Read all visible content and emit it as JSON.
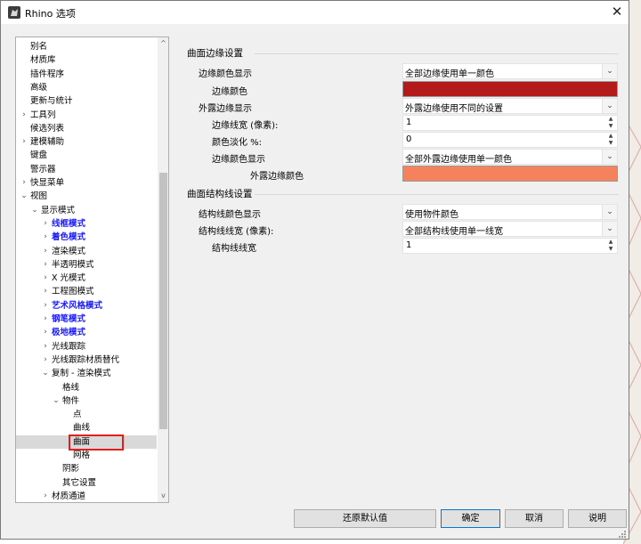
{
  "window": {
    "title": "Rhino 选项",
    "close_glyph": "✕"
  },
  "colors": {
    "edge_color": "#b31b1b",
    "naked_edge_color": "#f5825c",
    "selection_highlight": "#e0201c",
    "link_blue": "#1a1aff"
  },
  "tree": {
    "items": [
      {
        "label": "别名",
        "level": 0,
        "expander": "",
        "blue": false,
        "selected": false
      },
      {
        "label": "材质库",
        "level": 0,
        "expander": "",
        "blue": false,
        "selected": false
      },
      {
        "label": "插件程序",
        "level": 0,
        "expander": "",
        "blue": false,
        "selected": false
      },
      {
        "label": "高级",
        "level": 0,
        "expander": "",
        "blue": false,
        "selected": false
      },
      {
        "label": "更新与统计",
        "level": 0,
        "expander": "",
        "blue": false,
        "selected": false
      },
      {
        "label": "工具列",
        "level": 0,
        "expander": ">",
        "blue": false,
        "selected": false
      },
      {
        "label": "候选列表",
        "level": 0,
        "expander": "",
        "blue": false,
        "selected": false
      },
      {
        "label": "建模辅助",
        "level": 0,
        "expander": ">",
        "blue": false,
        "selected": false
      },
      {
        "label": "键盘",
        "level": 0,
        "expander": "",
        "blue": false,
        "selected": false
      },
      {
        "label": "警示器",
        "level": 0,
        "expander": "",
        "blue": false,
        "selected": false
      },
      {
        "label": "快显菜单",
        "level": 0,
        "expander": ">",
        "blue": false,
        "selected": false
      },
      {
        "label": "视图",
        "level": 0,
        "expander": "v",
        "blue": false,
        "selected": false
      },
      {
        "label": "显示模式",
        "level": 1,
        "expander": "v",
        "blue": false,
        "selected": false
      },
      {
        "label": "线框模式",
        "level": 2,
        "expander": ">",
        "blue": true,
        "selected": false
      },
      {
        "label": "着色模式",
        "level": 2,
        "expander": ">",
        "blue": true,
        "selected": false
      },
      {
        "label": "渲染模式",
        "level": 2,
        "expander": ">",
        "blue": false,
        "selected": false
      },
      {
        "label": "半透明模式",
        "level": 2,
        "expander": ">",
        "blue": false,
        "selected": false
      },
      {
        "label": "X 光模式",
        "level": 2,
        "expander": ">",
        "blue": false,
        "selected": false
      },
      {
        "label": "工程图模式",
        "level": 2,
        "expander": ">",
        "blue": false,
        "selected": false
      },
      {
        "label": "艺术风格模式",
        "level": 2,
        "expander": ">",
        "blue": true,
        "selected": false
      },
      {
        "label": "钢笔模式",
        "level": 2,
        "expander": ">",
        "blue": true,
        "selected": false
      },
      {
        "label": "极地模式",
        "level": 2,
        "expander": ">",
        "blue": true,
        "selected": false
      },
      {
        "label": "光线跟踪",
        "level": 2,
        "expander": ">",
        "blue": false,
        "selected": false
      },
      {
        "label": "光线跟踪材质替代",
        "level": 2,
        "expander": ">",
        "blue": false,
        "selected": false
      },
      {
        "label": "复制 - 渲染模式",
        "level": 2,
        "expander": "v",
        "blue": false,
        "selected": false
      },
      {
        "label": "格线",
        "level": 3,
        "expander": "",
        "blue": false,
        "selected": false
      },
      {
        "label": "物件",
        "level": 3,
        "expander": "v",
        "blue": false,
        "selected": false
      },
      {
        "label": "点",
        "level": 4,
        "expander": "",
        "blue": false,
        "selected": false
      },
      {
        "label": "曲线",
        "level": 4,
        "expander": "",
        "blue": false,
        "selected": false
      },
      {
        "label": "曲面",
        "level": 4,
        "expander": "",
        "blue": false,
        "selected": true
      },
      {
        "label": "网格",
        "level": 4,
        "expander": "",
        "blue": false,
        "selected": false
      },
      {
        "label": "阴影",
        "level": 3,
        "expander": "",
        "blue": false,
        "selected": false
      },
      {
        "label": "其它设置",
        "level": 3,
        "expander": "",
        "blue": false,
        "selected": false
      },
      {
        "label": "材质通道",
        "level": 2,
        "expander": ">",
        "blue": false,
        "selected": false
      }
    ],
    "scroll_up": "^",
    "scroll_down": "v"
  },
  "edge_settings": {
    "title": "曲面边缘设置",
    "edge_color_display_label": "边缘颜色显示",
    "edge_color_display_value": "全部边缘使用单一颜色",
    "edge_color_label": "边缘颜色",
    "naked_edge_display_label": "外露边缘显示",
    "naked_edge_display_value": "外露边缘使用不同的设置",
    "edge_thickness_label": "边缘线宽 (像素):",
    "edge_thickness_value": "1",
    "color_reduction_label": "颜色淡化 %:",
    "color_reduction_value": "0",
    "naked_edge_color_display_label": "边缘颜色显示",
    "naked_edge_color_display_value": "全部外露边缘使用单一颜色",
    "naked_edge_color_label": "外露边缘颜色"
  },
  "isocurve_settings": {
    "title": "曲面结构线设置",
    "color_display_label": "结构线颜色显示",
    "color_display_value": "使用物件颜色",
    "thickness_label": "结构线线宽 (像素):",
    "thickness_value": "全部结构线使用单一线宽",
    "width_label": "结构线线宽",
    "width_value": "1"
  },
  "buttons": {
    "restore": "还原默认值",
    "ok": "确定",
    "cancel": "取消",
    "help": "说明"
  }
}
